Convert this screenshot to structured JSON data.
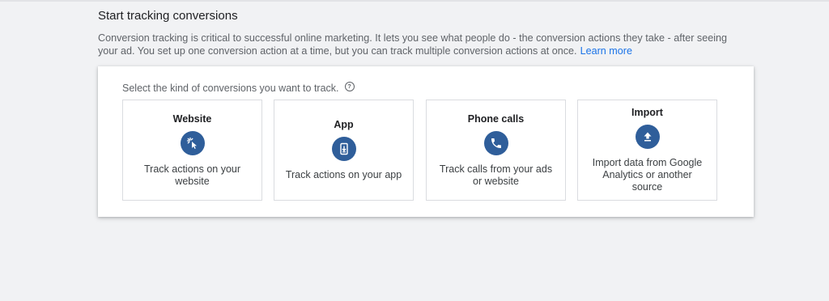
{
  "section": {
    "title": "Start tracking conversions",
    "description": "Conversion tracking is critical to successful online marketing. It lets you see what people do - the conversion actions they take - after seeing your ad. You set up one conversion action at a time, but you can track multiple conversion actions at once.",
    "learn_more": "Learn more"
  },
  "panel": {
    "prompt": "Select the kind of conversions you want to track.",
    "help_glyph": "?",
    "cards": [
      {
        "title": "Website",
        "icon": "cursor-click-icon",
        "description": "Track actions on your website"
      },
      {
        "title": "App",
        "icon": "smartphone-download-icon",
        "description": "Track actions on your app"
      },
      {
        "title": "Phone calls",
        "icon": "phone-icon",
        "description": "Track calls from your ads or website"
      },
      {
        "title": "Import",
        "icon": "upload-icon",
        "description": "Import data from Google Analytics or another source"
      }
    ]
  },
  "colors": {
    "background": "#f1f2f4",
    "icon_circle": "#2f5e9a",
    "link": "#1a73e8"
  }
}
